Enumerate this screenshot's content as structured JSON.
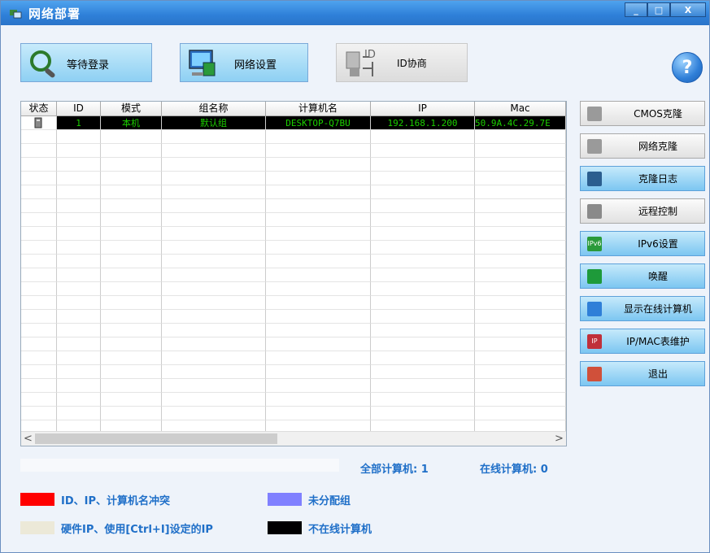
{
  "window": {
    "title": "网络部署",
    "min": "_",
    "max": "□",
    "close": "X"
  },
  "toolbar": {
    "wait_login": "等待登录",
    "network_settings": "网络设置",
    "id_negotiate": "ID协商",
    "id_icon_text": "ID",
    "help": "?"
  },
  "table": {
    "headers": [
      "状态",
      "ID",
      "模式",
      "组名称",
      "计算机名",
      "IP",
      "Mac"
    ],
    "rows": [
      {
        "id": "1",
        "mode": "本机",
        "group": "默认组",
        "name": "DESKTOP-Q7BU",
        "ip": "192.168.1.200",
        "mac": "50.9A.4C.29.7E"
      }
    ],
    "scroll_left": "<",
    "scroll_right": ">"
  },
  "side_buttons": [
    {
      "label": "CMOS克隆",
      "icon": "cmos-clone-icon",
      "style": "gray"
    },
    {
      "label": "网络克隆",
      "icon": "network-clone-icon",
      "style": "gray"
    },
    {
      "label": "克隆日志",
      "icon": "clone-log-icon",
      "style": "blue"
    },
    {
      "label": "远程控制",
      "icon": "remote-control-icon",
      "style": "gray"
    },
    {
      "label": "IPv6设置",
      "icon": "ipv6-icon",
      "style": "blue",
      "badge": "IPv6"
    },
    {
      "label": "唤醒",
      "icon": "power-icon",
      "style": "blue"
    },
    {
      "label": "显示在线计算机",
      "icon": "magnifier-icon",
      "style": "blue"
    },
    {
      "label": "IP/MAC表维护",
      "icon": "ip-table-icon",
      "style": "blue",
      "badge": "IP"
    },
    {
      "label": "退出",
      "icon": "exit-icon",
      "style": "blue"
    }
  ],
  "counts": {
    "total": "全部计算机: 1",
    "online": "在线计算机: 0"
  },
  "legend": [
    {
      "label": "ID、IP、计算机名冲突",
      "color": "#ff0000"
    },
    {
      "label": "未分配组",
      "color": "#8080ff"
    },
    {
      "label": "硬件IP、使用[Ctrl+I]设定的IP",
      "color": "#ece9d8"
    },
    {
      "label": "不在线计算机",
      "color": "#000000"
    }
  ]
}
